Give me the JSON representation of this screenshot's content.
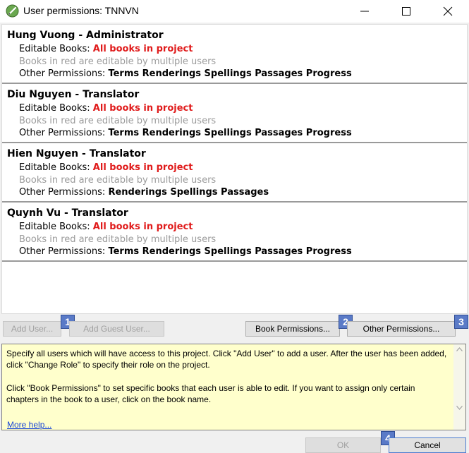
{
  "window": {
    "title": "User permissions: TNNVN"
  },
  "users": [
    {
      "name": "Hung Vuong - Administrator",
      "editable_label": "Editable Books:",
      "editable_value": "All books in project",
      "note": "Books in red are editable by multiple users",
      "other_label": "Other Permissions:",
      "other_value": "Terms Renderings Spellings Passages Progress"
    },
    {
      "name": "Diu Nguyen - Translator",
      "editable_label": "Editable Books:",
      "editable_value": "All books in project",
      "note": "Books in red are editable by multiple users",
      "other_label": "Other Permissions:",
      "other_value": "Terms Renderings Spellings Passages Progress"
    },
    {
      "name": "Hien Nguyen - Translator",
      "editable_label": "Editable Books:",
      "editable_value": "All books in project",
      "note": "Books in red are editable by multiple users",
      "other_label": "Other Permissions:",
      "other_value": "Renderings Spellings Passages"
    },
    {
      "name": "Quynh Vu - Translator",
      "editable_label": "Editable Books:",
      "editable_value": "All books in project",
      "note": "Books in red are editable by multiple users",
      "other_label": "Other Permissions:",
      "other_value": "Terms Renderings Spellings Passages Progress"
    }
  ],
  "buttons": {
    "add_user": "Add User...",
    "add_guest_user": "Add Guest User...",
    "book_permissions": "Book Permissions...",
    "other_permissions": "Other Permissions...",
    "ok": "OK",
    "cancel": "Cancel"
  },
  "badges": [
    "1",
    "2",
    "3",
    "4"
  ],
  "help": {
    "paragraph1": "Specify all users which will have access to this project. Click \"Add User\" to add a user. After the user has been added, click \"Change Role\" to specify their role on the project.",
    "paragraph2": "Click \"Book Permissions\" to set specific books that each user is able to edit. If you want to assign only certain chapters in the book to a user, click on the book name.",
    "link": "More help..."
  },
  "colors": {
    "editable_red": "#e01b1b",
    "note_gray": "#9b9b9b",
    "help_background": "#ffffcc",
    "badge_blue": "#5a7ac7",
    "link_blue": "#1a47d6"
  }
}
